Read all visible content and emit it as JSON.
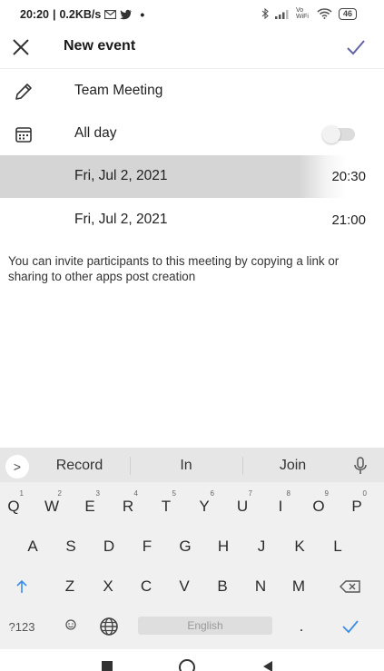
{
  "status": {
    "time": "20:20",
    "speed": "0.2KB/s",
    "battery": "46",
    "volte": "Vo WiFi"
  },
  "appbar": {
    "title": "New event"
  },
  "form": {
    "title": "Team Meeting",
    "all_day_label": "All day",
    "all_day_on": false,
    "start_date": "Fri, Jul 2, 2021",
    "start_time": "20:30",
    "end_date": "Fri, Jul 2, 2021",
    "end_time": "21:00",
    "info": "You can invite participants to this meeting by copying a link or sharing to other apps post creation"
  },
  "keyboard": {
    "suggestions": [
      "Record",
      "In",
      "Join"
    ],
    "row1": [
      "Q",
      "W",
      "E",
      "R",
      "T",
      "Y",
      "U",
      "I",
      "O",
      "P"
    ],
    "row1_hints": [
      "1",
      "2",
      "3",
      "4",
      "5",
      "6",
      "7",
      "8",
      "9",
      "0"
    ],
    "row2": [
      "A",
      "S",
      "D",
      "F",
      "G",
      "H",
      "J",
      "K",
      "L"
    ],
    "row3": [
      "Z",
      "X",
      "C",
      "V",
      "B",
      "N",
      "M"
    ],
    "symbols_label": "?123",
    "space_label": "English",
    "period": "."
  },
  "colors": {
    "accent": "#6264a7",
    "keyboard_blue": "#3b8ee6",
    "highlight": "#d5d5d5"
  }
}
